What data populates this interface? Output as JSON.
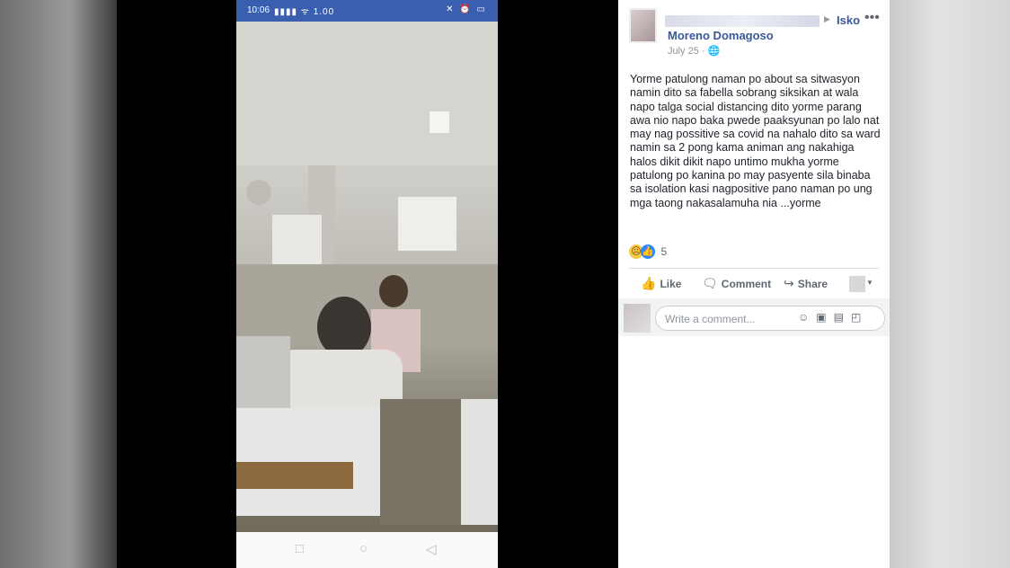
{
  "phone": {
    "status_time": "10:06",
    "status_signal": "▮▮▮▮ ᯤ 1.00",
    "status_right": "✕ ⏰ ▭"
  },
  "post": {
    "shared_to": "Isko",
    "page_name": "Moreno Domagoso",
    "date": "July 25 · ",
    "body": "Yorme patulong naman po about sa sitwasyon namin dito sa fabella sobrang siksikan at wala napo talga social distancing dito yorme parang awa nio napo baka pwede paaksyunan po lalo nat may nag possitive sa covid na nahalo dito sa ward namin sa 2 pong kama animan ang nakahiga halos dikit dikit napo untimo mukha yorme patulong po kanina po may pasyente sila binaba sa isolation kasi nagpositive pano naman po ung mga taong nakasalamuha nia ...yorme",
    "reaction_count": "5",
    "actions": {
      "like": "Like",
      "comment": "Comment",
      "share": "Share"
    },
    "comment_placeholder": "Write a comment..."
  },
  "colors": {
    "fb_blue": "#385898",
    "status_bar": "#3a5fb0"
  }
}
